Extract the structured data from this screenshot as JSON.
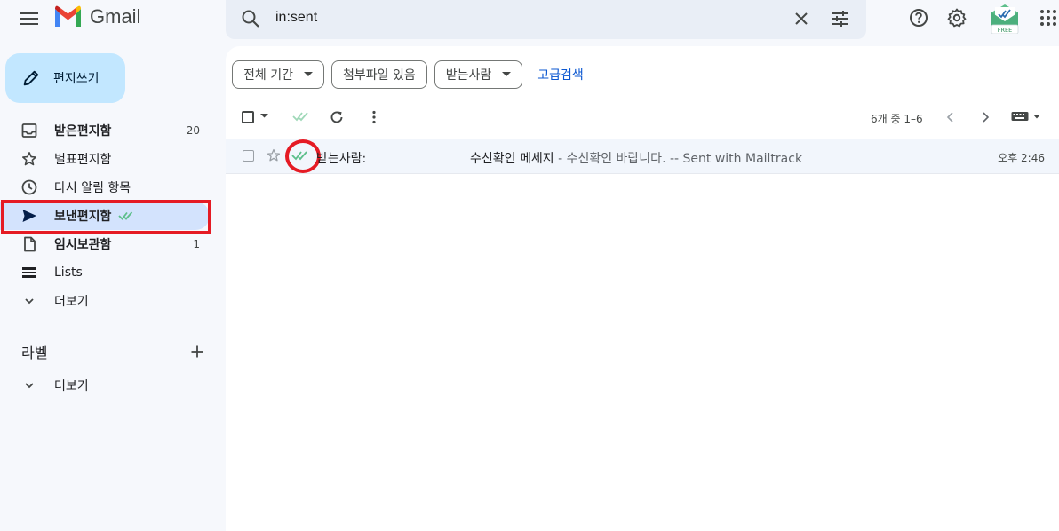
{
  "header": {
    "app_name": "Gmail",
    "search_value": "in:sent",
    "mailtrack_badge": "FREE"
  },
  "sidebar": {
    "compose_label": "편지쓰기",
    "items": [
      {
        "label": "받은편지함",
        "count": "20"
      },
      {
        "label": "별표편지함",
        "count": ""
      },
      {
        "label": "다시 알림 항목",
        "count": ""
      },
      {
        "label": "보낸편지함",
        "count": ""
      },
      {
        "label": "임시보관함",
        "count": "1"
      },
      {
        "label": "Lists",
        "count": ""
      },
      {
        "label": "더보기",
        "count": ""
      }
    ],
    "labels_title": "라벨",
    "labels_more": "더보기"
  },
  "filters": {
    "chips": [
      "전체 기간",
      "첨부파일 있음",
      "받는사람"
    ],
    "advanced_search": "고급검색"
  },
  "toolbar": {
    "range_text": "6개 중 1–6"
  },
  "messages": [
    {
      "sender": "받는사람:",
      "subject": "수신확인 메세지",
      "snippet": " - 수신확인 바랍니다. -- Sent with Mailtrack",
      "time": "오후 2:46"
    }
  ],
  "colors": {
    "accent": "#0b57d0",
    "compose_bg": "#c2e7ff",
    "active_nav": "#d3e3fd",
    "annotation_red": "#e51b24",
    "mailtrack_green": "#5dbf8b"
  }
}
